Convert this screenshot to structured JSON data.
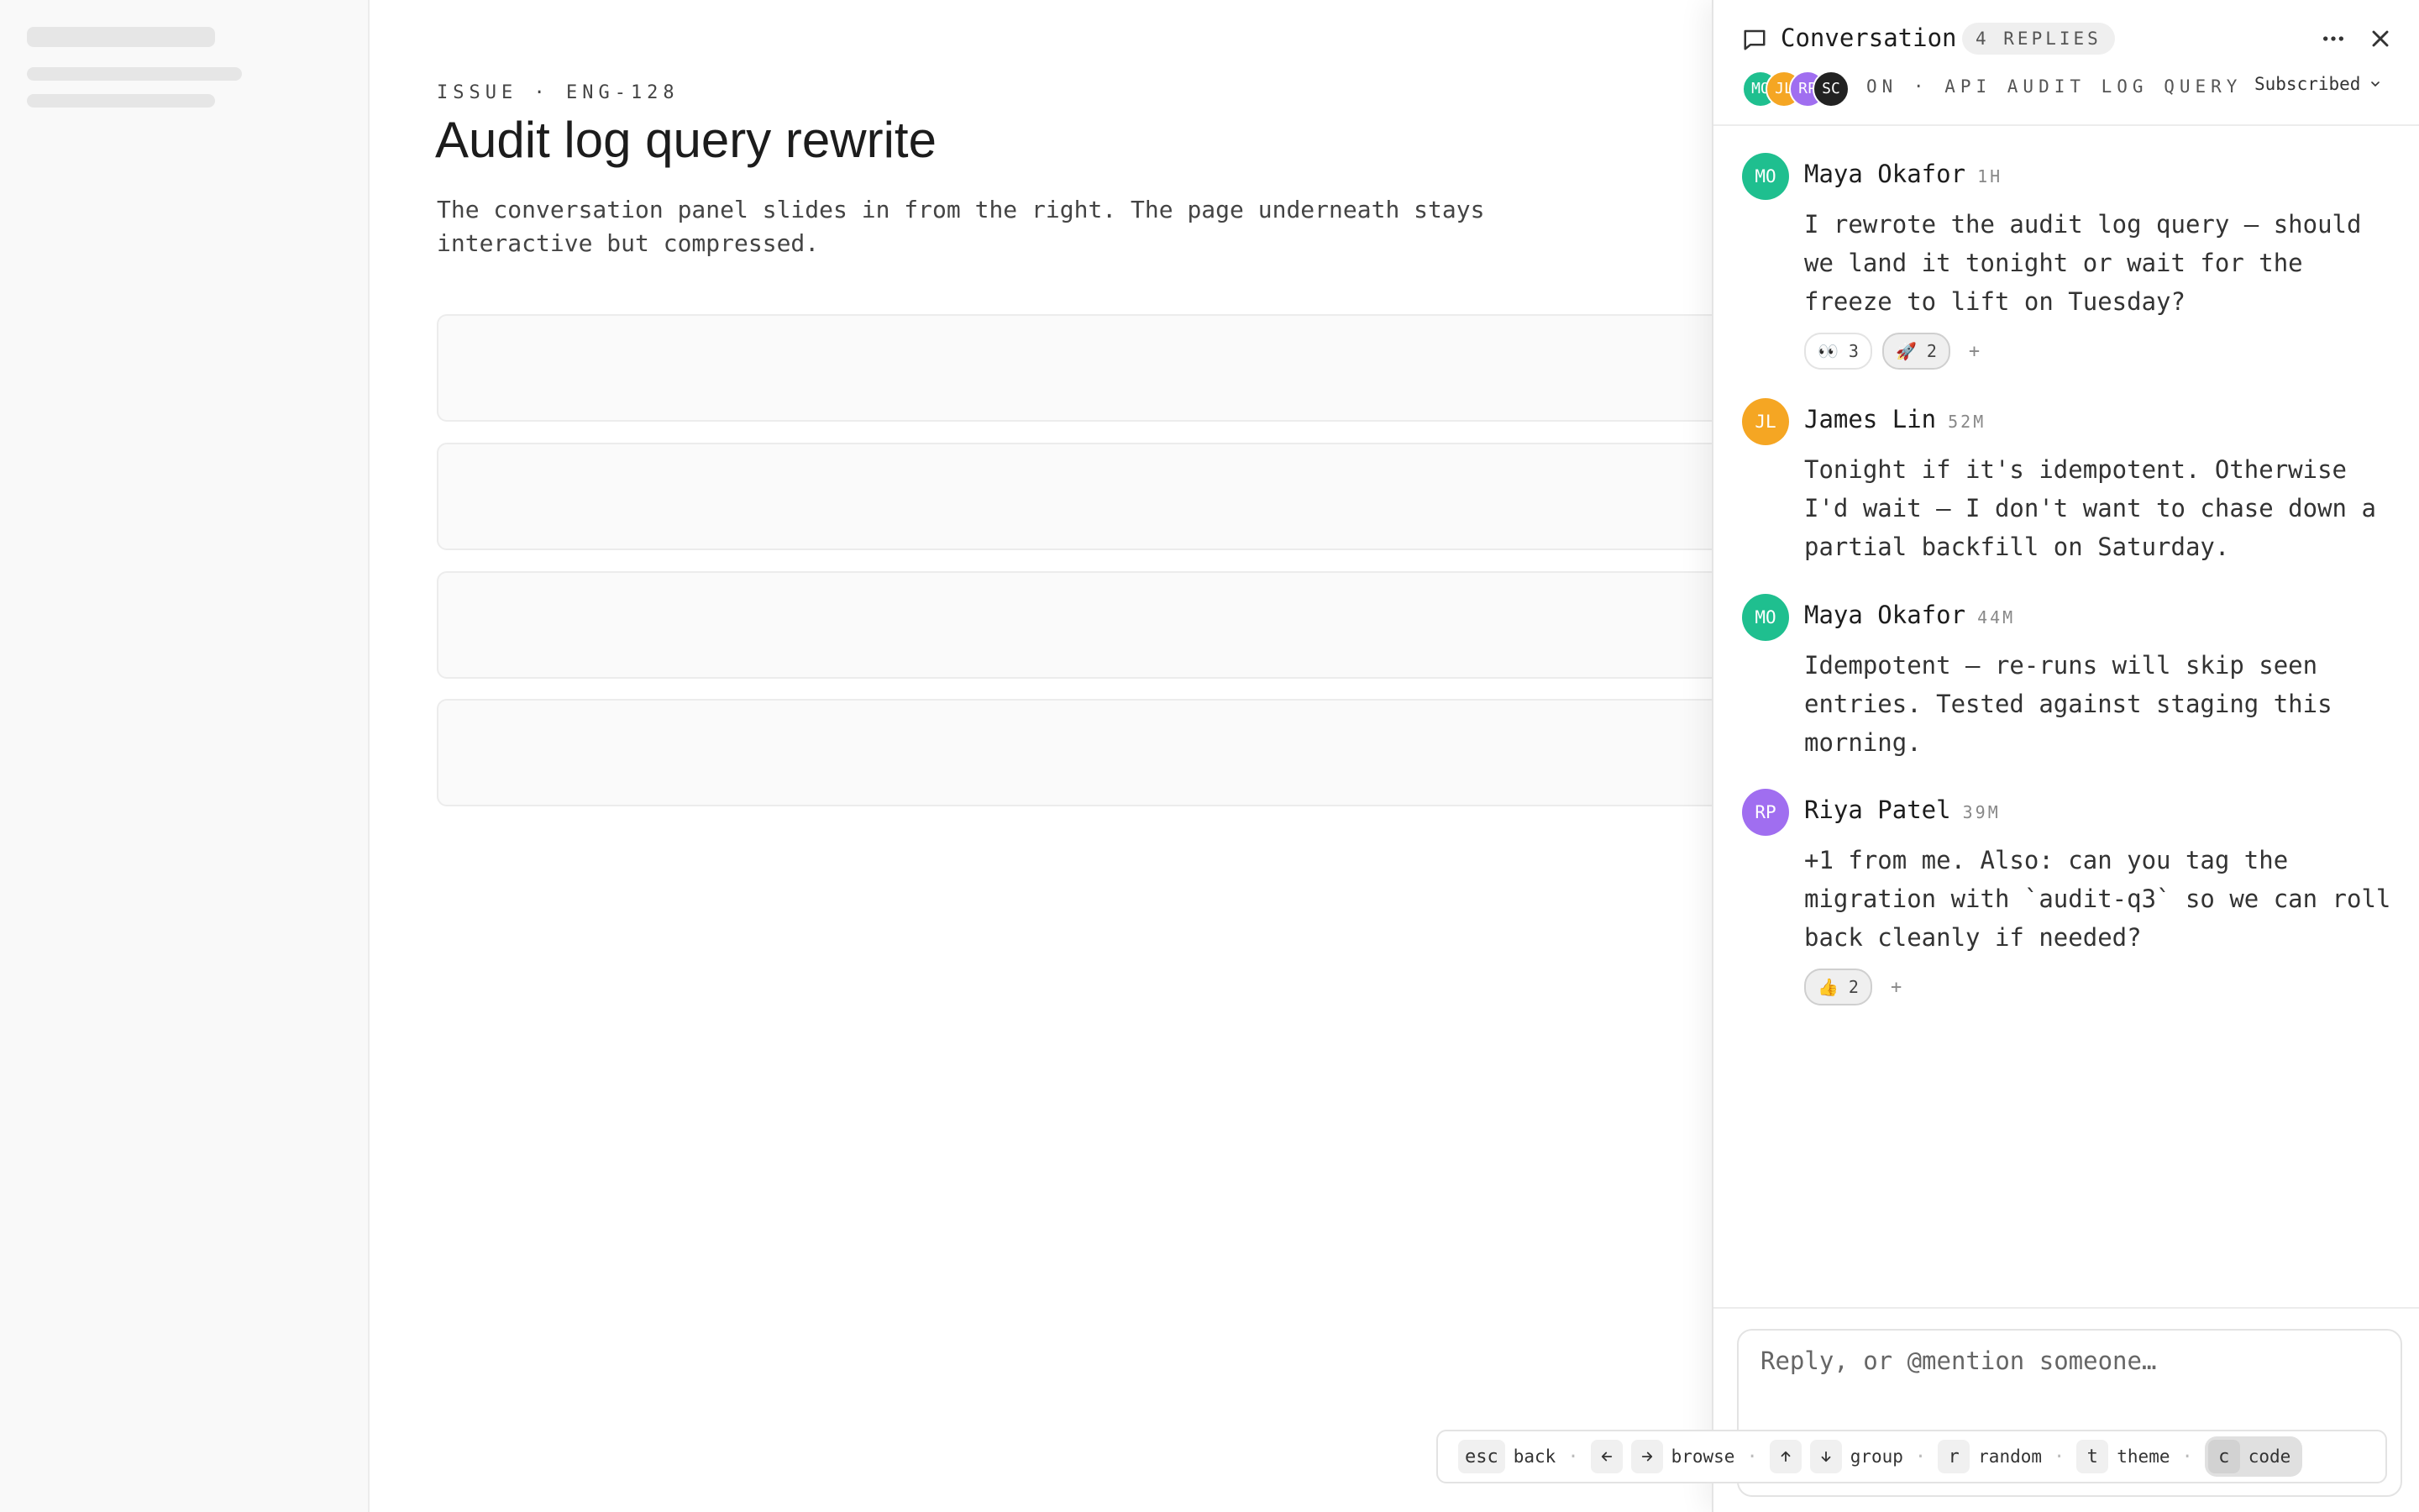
{
  "main": {
    "eyebrow": "ISSUE · ENG-128",
    "title": "Audit log query rewrite",
    "description": "The conversation panel slides in from the right. The page underneath stays interactive but compressed."
  },
  "panel": {
    "title": "Conversation",
    "replies_badge": "4 REPLIES",
    "context": "ON · API AUDIT LOG QUERY",
    "subscribed_label": "Subscribed",
    "participants": [
      {
        "initials": "MO",
        "color": "#1fbf8f"
      },
      {
        "initials": "JL",
        "color": "#f5a623"
      },
      {
        "initials": "RP",
        "color": "#a06ef0"
      },
      {
        "initials": "SC",
        "color": "#222222"
      }
    ],
    "messages": [
      {
        "initials": "MO",
        "color": "#1fbf8f",
        "author": "Maya Okafor",
        "time": "1H",
        "body": "I rewrote the audit log query — should we land it tonight or wait for the freeze to lift on Tuesday?",
        "reactions": [
          {
            "emoji": "👀",
            "count": "3",
            "active": false
          },
          {
            "emoji": "🚀",
            "count": "2",
            "active": true
          }
        ]
      },
      {
        "initials": "JL",
        "color": "#f5a623",
        "author": "James Lin",
        "time": "52M",
        "body": "Tonight if it's idempotent. Otherwise I'd wait — I don't want to chase down a partial backfill on Saturday.",
        "reactions": []
      },
      {
        "initials": "MO",
        "color": "#1fbf8f",
        "author": "Maya Okafor",
        "time": "44M",
        "body": "Idempotent — re-runs will skip seen entries. Tested against staging this morning.",
        "reactions": []
      },
      {
        "initials": "RP",
        "color": "#a06ef0",
        "author": "Riya Patel",
        "time": "39M",
        "body": "+1 from me. Also: can you tag the migration with `audit-q3` so we can roll back cleanly if needed?",
        "reactions": [
          {
            "emoji": "👍",
            "count": "2",
            "active": true
          }
        ]
      }
    ],
    "add_reaction": "+",
    "composer": {
      "placeholder": "Reply, or @mention someone…"
    }
  },
  "shortcuts": {
    "esc_key": "esc",
    "esc_label": "back",
    "browse_label": "browse",
    "group_label": "group",
    "random_key": "r",
    "random_label": "random",
    "theme_key": "t",
    "theme_label": "theme",
    "code_key": "c",
    "code_label": "code",
    "sep": "·"
  },
  "icons": [
    "chat-bubble-icon",
    "more-icon",
    "close-icon",
    "chevron-down-icon",
    "arrow-left-icon",
    "arrow-right-icon",
    "arrow-up-icon",
    "arrow-down-icon"
  ]
}
